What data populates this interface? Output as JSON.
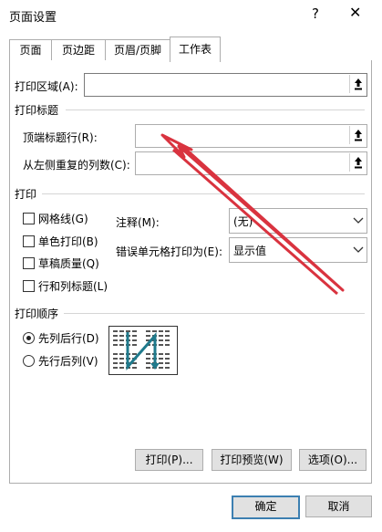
{
  "window": {
    "title": "页面设置",
    "help": "?",
    "close": "✕"
  },
  "tabs": [
    {
      "label": "页面"
    },
    {
      "label": "页边距"
    },
    {
      "label": "页眉/页脚"
    },
    {
      "label": "工作表"
    }
  ],
  "print_area": {
    "label": "打印区域(A):",
    "value": ""
  },
  "print_titles": {
    "heading": "打印标题",
    "rows": {
      "label": "顶端标题行(R):",
      "value": ""
    },
    "cols": {
      "label": "从左侧重复的列数(C):",
      "value": ""
    }
  },
  "print": {
    "heading": "打印",
    "checkboxes": [
      {
        "label": "网格线(G)",
        "checked": false
      },
      {
        "label": "单色打印(B)",
        "checked": false
      },
      {
        "label": "草稿质量(Q)",
        "checked": false
      },
      {
        "label": "行和列标题(L)",
        "checked": false
      }
    ],
    "comments": {
      "label": "注释(M):",
      "value": "(无)"
    },
    "cell_errors": {
      "label": "错误单元格打印为(E):",
      "value": "显示值"
    }
  },
  "page_order": {
    "heading": "打印顺序",
    "options": [
      {
        "label": "先列后行(D)",
        "selected": true
      },
      {
        "label": "先行后列(V)",
        "selected": false
      }
    ]
  },
  "actions": {
    "print": "打印(P)...",
    "preview": "打印预览(W)",
    "options": "选项(O)..."
  },
  "footer": {
    "ok": "确定",
    "cancel": "取消"
  },
  "colors": {
    "annotation_arrow": "#d9333f",
    "focus_border": "#3c7fb1",
    "order_arrow": "#1f7a8c"
  }
}
